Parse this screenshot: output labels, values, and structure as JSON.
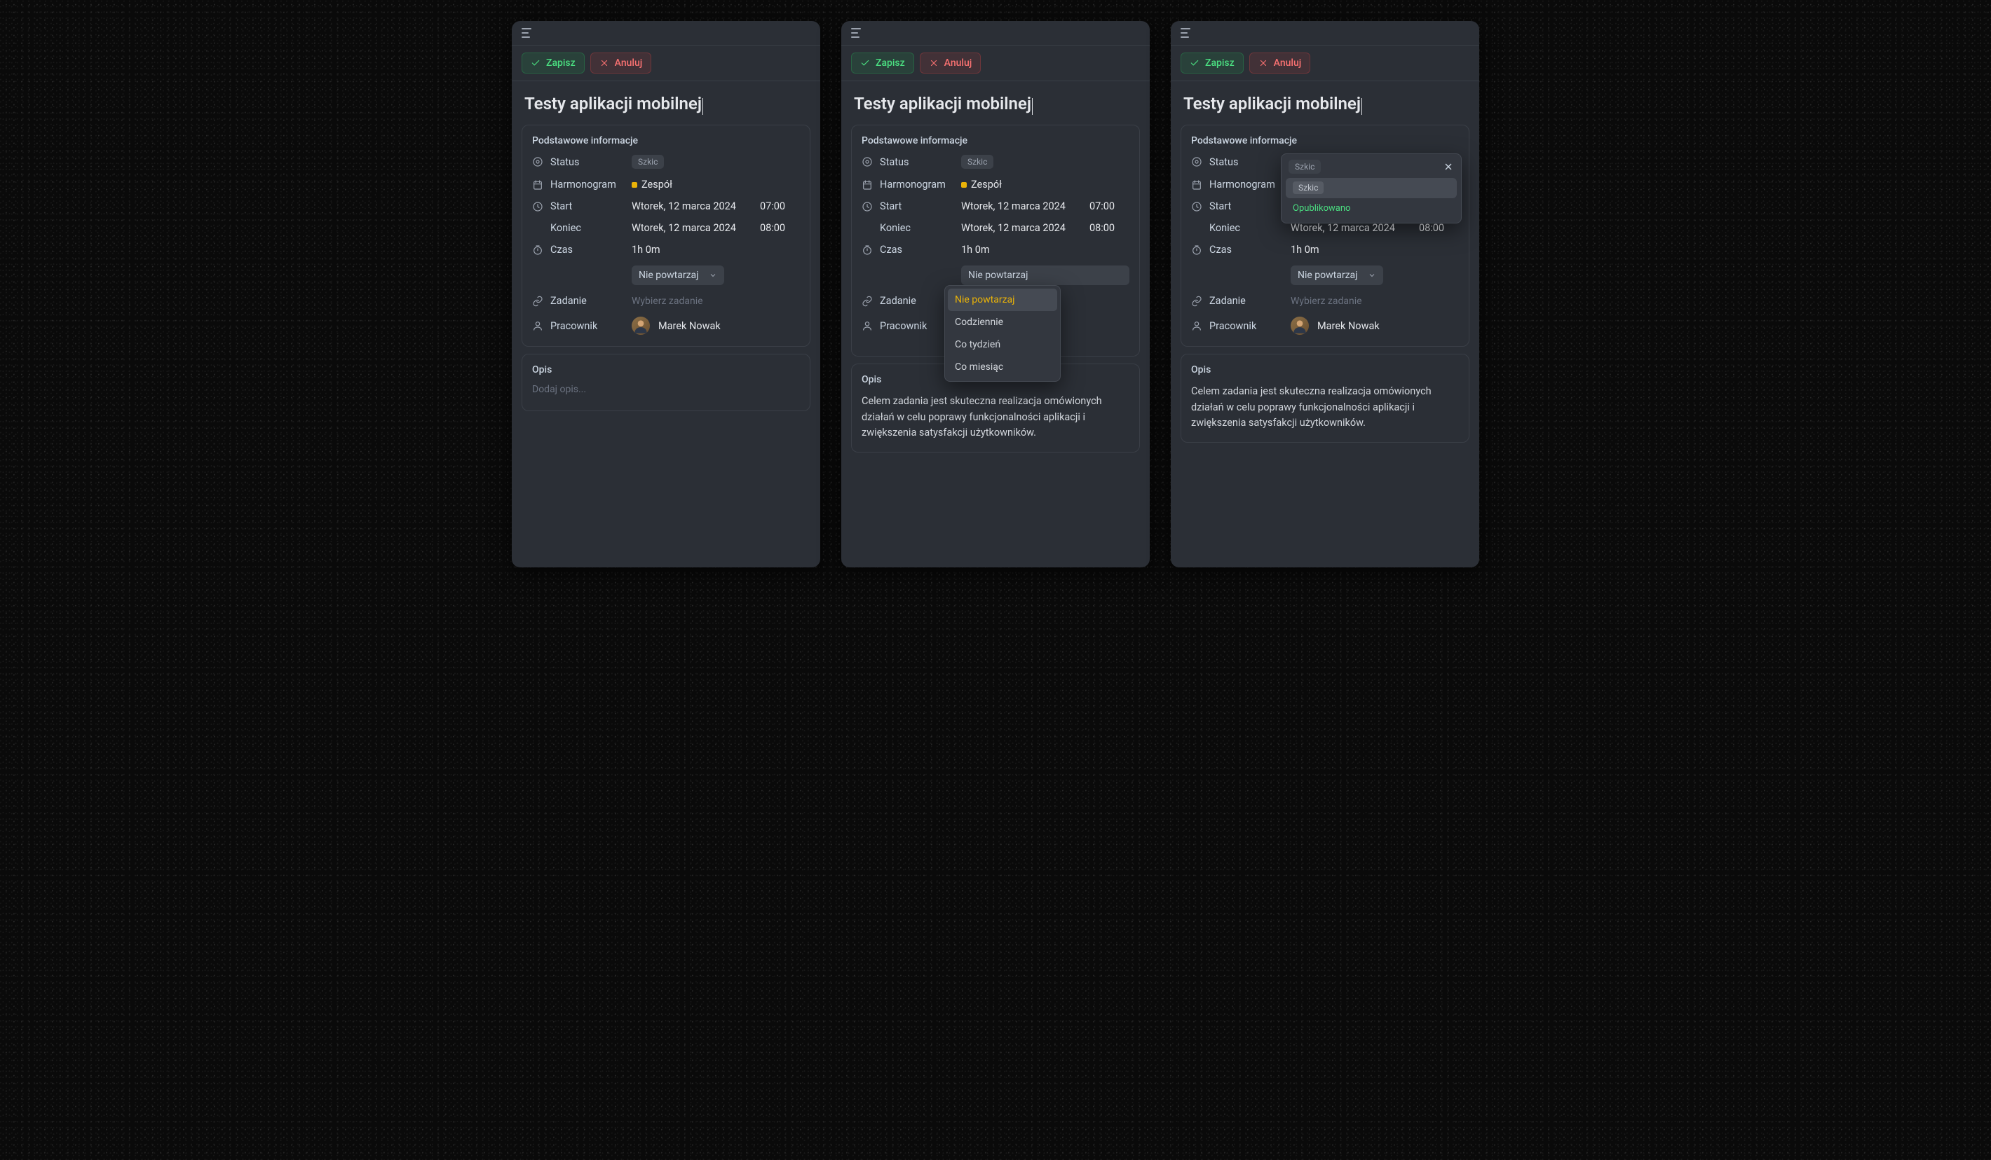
{
  "toolbar": {
    "save_label": "Zapisz",
    "cancel_label": "Anuluj"
  },
  "title": "Testy aplikacji mobilnej",
  "section_basic_title": "Podstawowe informacje",
  "labels": {
    "status": "Status",
    "schedule": "Harmonogram",
    "start": "Start",
    "end": "Koniec",
    "duration": "Czas",
    "task": "Zadanie",
    "employee": "Pracownik"
  },
  "values": {
    "status_badge": "Szkic",
    "team": "Zespół",
    "start_date": "Wtorek, 12 marca 2024",
    "start_time": "07:00",
    "end_date": "Wtorek, 12 marca 2024",
    "end_time": "08:00",
    "duration": "1h 0m",
    "repeat": "Nie powtarzaj",
    "task_placeholder": "Wybierz zadanie",
    "employee_name": "Marek Nowak"
  },
  "opis": {
    "title": "Opis",
    "placeholder": "Dodaj opis...",
    "text": "Celem zadania jest skuteczna realizacja omówionych działań w celu poprawy funkcjonalności aplikacji i zwiększenia satysfakcji użytkowników."
  },
  "repeat_options": [
    "Nie powtarzaj",
    "Codziennie",
    "Co tydzień",
    "Co miesiąc"
  ],
  "status_options": {
    "draft": "Szkic",
    "published": "Opublikowano"
  }
}
